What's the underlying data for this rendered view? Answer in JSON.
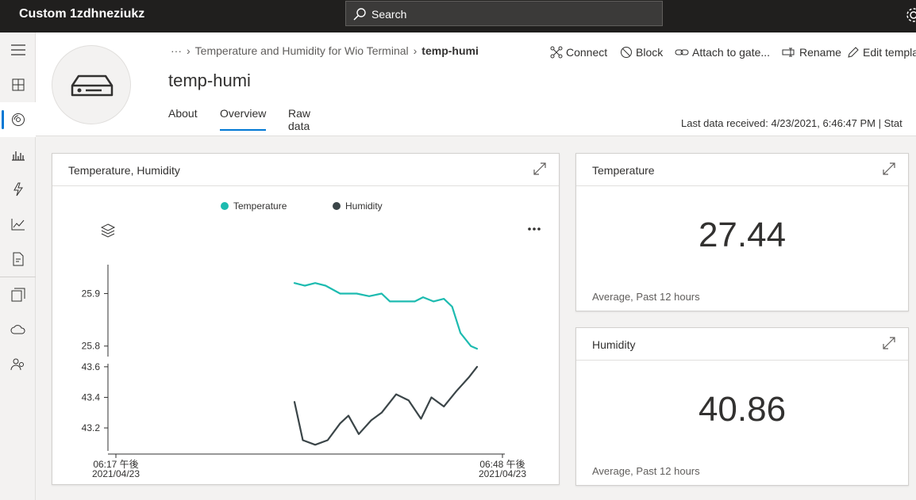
{
  "app": {
    "title": "Custom 1zdhneziukz",
    "search_label": "Search"
  },
  "breadcrumb": {
    "ellipsis": "···",
    "parent": "Temperature and Humidity for Wio Terminal",
    "current": "temp-humi"
  },
  "device": {
    "name": "temp-humi"
  },
  "tabs": [
    {
      "label": "About"
    },
    {
      "label": "Overview"
    },
    {
      "label": "Raw data"
    }
  ],
  "actions": {
    "connect": "Connect",
    "block": "Block",
    "attach": "Attach to gate...",
    "rename": "Rename",
    "edit": "Edit templa"
  },
  "last_data": "Last data received: 4/23/2021, 6:46:47 PM  |  Stat",
  "chart_card": {
    "title": "Temperature, Humidity"
  },
  "kpi_temp": {
    "title": "Temperature",
    "value": "27.44",
    "foot": "Average, Past 12 hours"
  },
  "kpi_humi": {
    "title": "Humidity",
    "value": "40.86",
    "foot": "Average, Past 12 hours"
  },
  "colors": {
    "temperature": "#1dbbb0",
    "humidity": "#3b4548",
    "accent": "#0078d4"
  },
  "chart_data": {
    "type": "line",
    "x_labels": [
      "06:17 午後\n2021/04/23",
      "06:48 午後\n2021/04/23"
    ],
    "x_label_lines": [
      [
        "06:17 午後",
        "2021/04/23"
      ],
      [
        "06:48 午後",
        "2021/04/23"
      ]
    ],
    "series": [
      {
        "name": "Temperature",
        "yticks": [
          "25.9",
          "25.8"
        ],
        "ylim": [
          25.78,
          25.955
        ],
        "points": [
          [
            0.0,
            25.92
          ],
          [
            0.05,
            25.915
          ],
          [
            0.1,
            25.92
          ],
          [
            0.15,
            25.915
          ],
          [
            0.22,
            25.9
          ],
          [
            0.3,
            25.9
          ],
          [
            0.36,
            25.895
          ],
          [
            0.42,
            25.9
          ],
          [
            0.46,
            25.885
          ],
          [
            0.52,
            25.885
          ],
          [
            0.58,
            25.885
          ],
          [
            0.62,
            25.893
          ],
          [
            0.67,
            25.885
          ],
          [
            0.72,
            25.89
          ],
          [
            0.76,
            25.875
          ],
          [
            0.8,
            25.825
          ],
          [
            0.85,
            25.8
          ],
          [
            0.88,
            25.795
          ]
        ]
      },
      {
        "name": "Humidity",
        "yticks": [
          "43.6",
          "43.4",
          "43.2"
        ],
        "ylim": [
          43.05,
          43.62
        ],
        "points": [
          [
            0.0,
            43.37
          ],
          [
            0.04,
            43.12
          ],
          [
            0.1,
            43.09
          ],
          [
            0.16,
            43.12
          ],
          [
            0.22,
            43.23
          ],
          [
            0.26,
            43.28
          ],
          [
            0.31,
            43.16
          ],
          [
            0.37,
            43.25
          ],
          [
            0.42,
            43.3
          ],
          [
            0.49,
            43.42
          ],
          [
            0.55,
            43.38
          ],
          [
            0.61,
            43.26
          ],
          [
            0.66,
            43.4
          ],
          [
            0.72,
            43.34
          ],
          [
            0.78,
            43.44
          ],
          [
            0.84,
            43.53
          ],
          [
            0.88,
            43.6
          ]
        ]
      }
    ]
  }
}
